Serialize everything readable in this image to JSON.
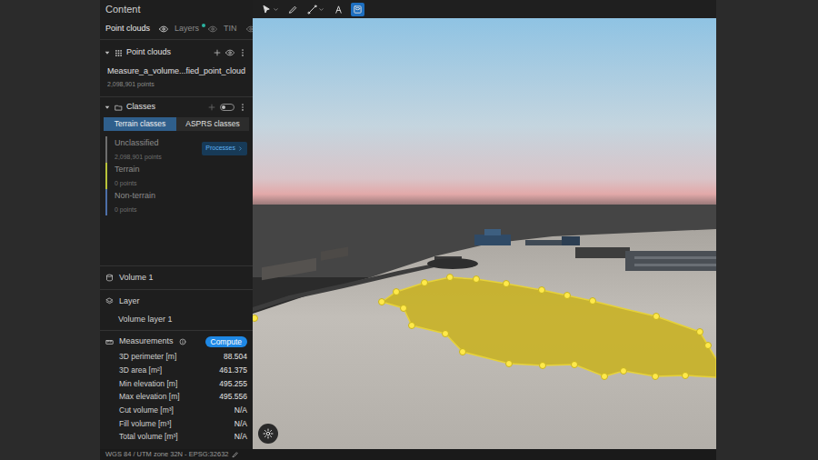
{
  "sidebar": {
    "title": "Content",
    "tabs": [
      {
        "label": "Point clouds",
        "selected": true,
        "badge": false
      },
      {
        "label": "Layers",
        "selected": false,
        "badge": true
      },
      {
        "label": "TIN",
        "selected": false,
        "badge": false
      }
    ],
    "point_clouds": {
      "title": "Point clouds",
      "expanded": true,
      "items": [
        {
          "name": "Measure_a_volume...fied_point_cloud",
          "count": "2,098,901 points"
        }
      ]
    },
    "classes": {
      "title": "Classes",
      "expanded": true,
      "toggle_on": false,
      "modes": [
        {
          "label": "Terrain classes",
          "selected": true
        },
        {
          "label": "ASPRS classes",
          "selected": false
        }
      ],
      "items": [
        {
          "name": "Unclassified",
          "count": "2,098,901 points",
          "color": "#6e6e6e"
        },
        {
          "name": "Terrain",
          "count": "0 points",
          "color": "#b9c33a"
        },
        {
          "name": "Non-terrain",
          "count": "0 points",
          "color": "#4d6fa8"
        }
      ],
      "process_button": "Processes"
    },
    "volume": {
      "title": "Volume 1",
      "layer_heading": "Layer",
      "layer_name": "Volume layer 1",
      "measurements_heading": "Measurements",
      "compute_button": "Compute",
      "rows": [
        {
          "label": "3D perimeter [m]",
          "value": "88.504"
        },
        {
          "label": "3D area [m²]",
          "value": "461.375"
        },
        {
          "label": "Min elevation [m]",
          "value": "495.255"
        },
        {
          "label": "Max elevation [m]",
          "value": "495.556"
        },
        {
          "label": "Cut volume [m³]",
          "value": "N/A"
        },
        {
          "label": "Fill volume [m³]",
          "value": "N/A"
        },
        {
          "label": "Total volume [m³]",
          "value": "N/A"
        }
      ]
    },
    "status_bar": "WGS 84 / UTM zone 32N - EPSG:32632"
  },
  "toolbar": {
    "tools": [
      {
        "kind": "select",
        "selected": false
      },
      {
        "kind": "draw",
        "selected": false
      },
      {
        "kind": "measure",
        "selected": false
      },
      {
        "kind": "label",
        "selected": false
      },
      {
        "kind": "volume",
        "selected": true
      }
    ]
  }
}
